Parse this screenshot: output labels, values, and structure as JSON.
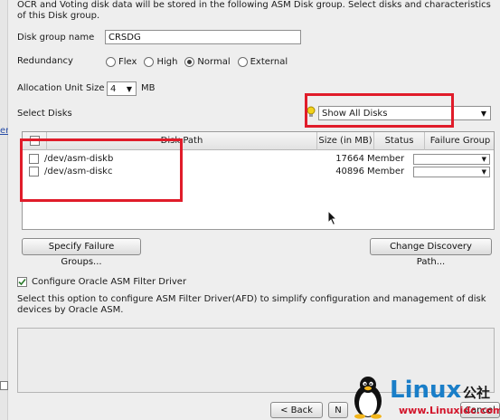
{
  "description_lines": [
    "OCR and Voting disk data will be stored in the following ASM Disk group. Select disks and characteristics",
    "of this Disk group."
  ],
  "left_link_text": "er",
  "disk_group": {
    "label": "Disk group name",
    "value": "CRSDG"
  },
  "redundancy": {
    "label": "Redundancy",
    "options": [
      {
        "label": "Flex",
        "selected": false
      },
      {
        "label": "High",
        "selected": false
      },
      {
        "label": "Normal",
        "selected": true
      },
      {
        "label": "External",
        "selected": false
      }
    ]
  },
  "allocation": {
    "label": "Allocation Unit Size",
    "value": "4",
    "unit": "MB"
  },
  "select_disks": {
    "label": "Select Disks",
    "filter_value": "Show All Disks",
    "hint_icon": "lightbulb-icon"
  },
  "table": {
    "headers": [
      "Disk Path",
      "Size (in MB)",
      "Status",
      "Failure Group"
    ],
    "rows": [
      {
        "path": "/dev/asm-diskb",
        "size": "17664",
        "status": "Member"
      },
      {
        "path": "/dev/asm-diskc",
        "size": "40896",
        "status": "Member"
      }
    ]
  },
  "buttons": {
    "specify_failure_groups": "Specify Failure Groups...",
    "change_discovery_path": "Change Discovery Path...",
    "back": "< Back",
    "next": "N",
    "cancel": "Cancel"
  },
  "afd": {
    "checked": true,
    "label": "Configure Oracle ASM Filter Driver",
    "help_lines": [
      "Select this option to configure ASM Filter Driver(AFD) to simplify configuration and management of disk",
      "devices by Oracle ASM."
    ]
  },
  "watermark": {
    "brand": "Linux",
    "cn": "公社",
    "url": "www.Linuxidc.com"
  },
  "colors": {
    "highlight_red": "#e01c2a",
    "watermark_blue": "#1a7ec8",
    "link_blue": "#2a4fa8"
  }
}
